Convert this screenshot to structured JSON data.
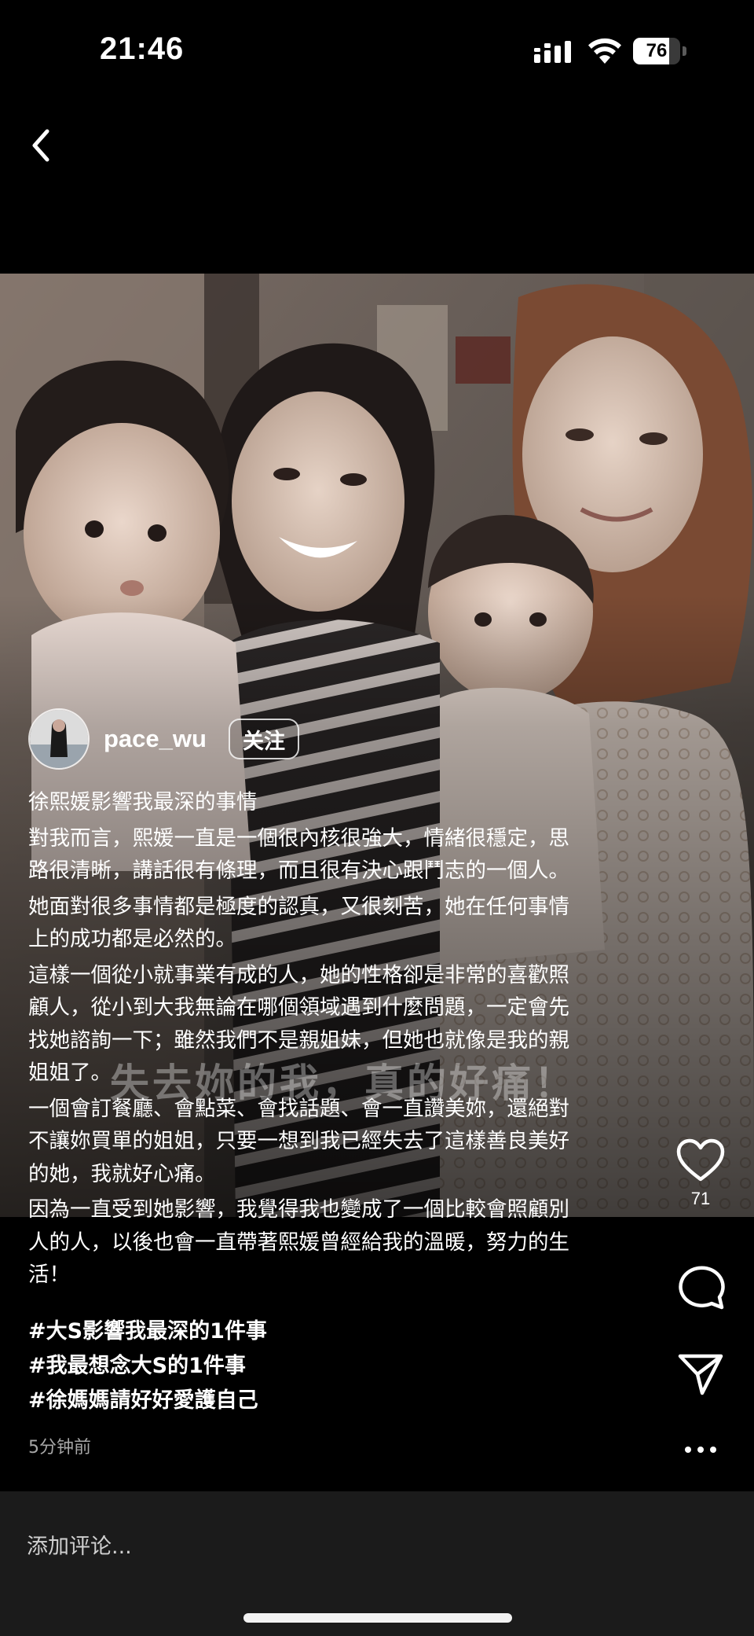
{
  "status_bar": {
    "time": "21:46",
    "battery": "76",
    "battery_level": 0.76,
    "icons": [
      "signal-icon",
      "wifi-icon",
      "battery-icon"
    ]
  },
  "nav": {
    "back_icon": "chevron-left-icon"
  },
  "media": {
    "overlay_caption": "失去妳的我，真的好痛！"
  },
  "author": {
    "username": "pace_wu",
    "follow_label": "关注"
  },
  "post": {
    "title": "徐熙媛影響我最深的事情",
    "paragraphs": [
      "對我而言，熙媛一直是一個很內核很強大，情緒很穩定，思\n路很清晰，講話很有條理，而且很有決心跟鬥志的一個人。",
      "她面對很多事情都是極度的認真，又很刻苦，她在任何事情\n上的成功都是必然的。",
      "這樣一個從小就事業有成的人，她的性格卻是非常的喜歡照\n顧人，從小到大我無論在哪個領域遇到什麼問題，一定會先\n找她諮詢一下；雖然我們不是親姐妹，但她也就像是我的親\n姐姐了。",
      "一個會訂餐廳、會點菜、會找話題、會一直讚美妳，還絕對\n不讓妳買單的姐姐，只要一想到我已經失去了這樣善良美好\n的她，我就好心痛。",
      "因為一直受到她影響，我覺得我也變成了一個比較會照顧別\n人的人，以後也會一直帶著熙媛曾經給我的溫暖，努力的生\n活！"
    ],
    "hashtags": [
      "#大S影響我最深的1件事",
      "#我最想念大S的1件事",
      "#徐媽媽請好好愛護自己"
    ],
    "timestamp": "5分钟前"
  },
  "actions": {
    "like_count": "71",
    "icons": [
      "heart-icon",
      "comment-icon",
      "share-icon",
      "more-icon"
    ]
  },
  "comment": {
    "placeholder": "添加评论..."
  },
  "colors": {
    "background": "#000000",
    "comment_bar": "#1b1b1b",
    "muted_text": "#a7a7a7"
  }
}
